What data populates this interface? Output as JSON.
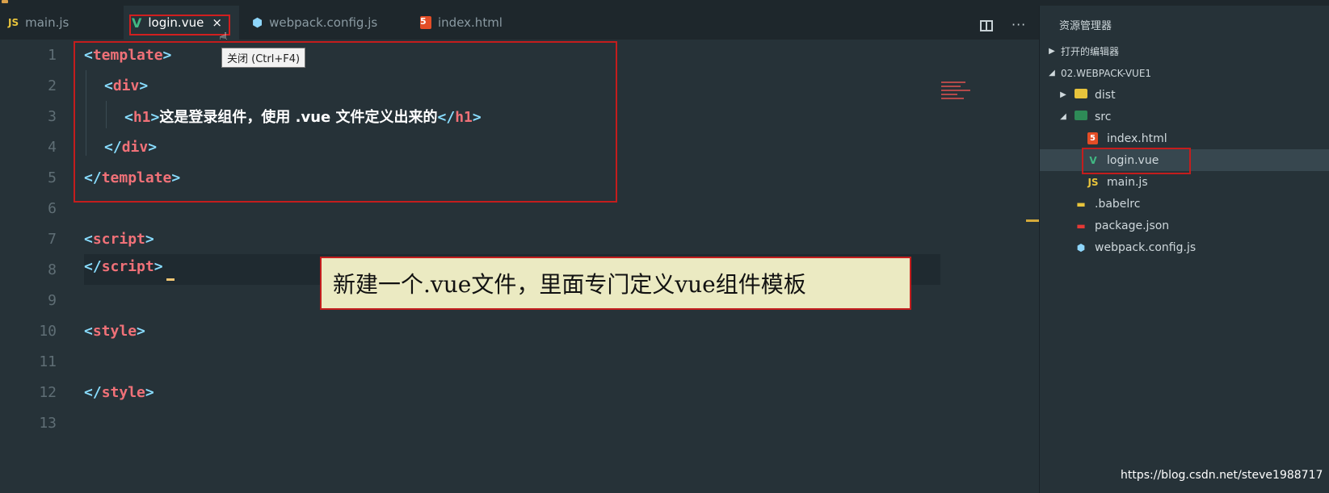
{
  "tabs": [
    {
      "icon": "JS",
      "label": "main.js"
    },
    {
      "icon": "V",
      "label": "login.vue",
      "close": "×"
    },
    {
      "icon": "⬢",
      "label": "webpack.config.js"
    },
    {
      "icon": "5",
      "label": "index.html"
    }
  ],
  "tooltip": "关闭 (Ctrl+F4)",
  "toolbar": {
    "more": "···"
  },
  "editor": {
    "line_numbers": [
      "1",
      "2",
      "3",
      "4",
      "5",
      "6",
      "7",
      "8",
      "9",
      "10",
      "11",
      "12",
      "13"
    ],
    "h1_text": "这是登录组件，使用 .vue 文件定义出来的",
    "current_line": "8"
  },
  "annotation": "新建一个.vue文件，里面专门定义vue组件模板",
  "explorer": {
    "title": "资源管理器",
    "open_editors": "打开的编辑器",
    "project": "02.WEBPACK-VUE1",
    "items": [
      {
        "name": "dist",
        "type": "folder",
        "icon": "folder-icon"
      },
      {
        "name": "src",
        "type": "folder",
        "icon": "folder-icon"
      },
      {
        "name": "index.html",
        "type": "file",
        "icon": "5"
      },
      {
        "name": "login.vue",
        "type": "file",
        "icon": "V"
      },
      {
        "name": "main.js",
        "type": "file",
        "icon": "JS"
      },
      {
        "name": ".babelrc",
        "type": "file",
        "icon": "babel-icon"
      },
      {
        "name": "package.json",
        "type": "file",
        "icon": "npm-icon"
      },
      {
        "name": "webpack.config.js",
        "type": "file",
        "icon": "⬢"
      }
    ]
  },
  "watermark": "https://blog.csdn.net/steve1988717",
  "colors": {
    "background": "#263238",
    "tabbar": "#1e272c",
    "tag": "#f07178",
    "punctuation": "#89ddff",
    "highlight_border": "#c41d1d",
    "annotation_bg": "#ebeac2"
  }
}
